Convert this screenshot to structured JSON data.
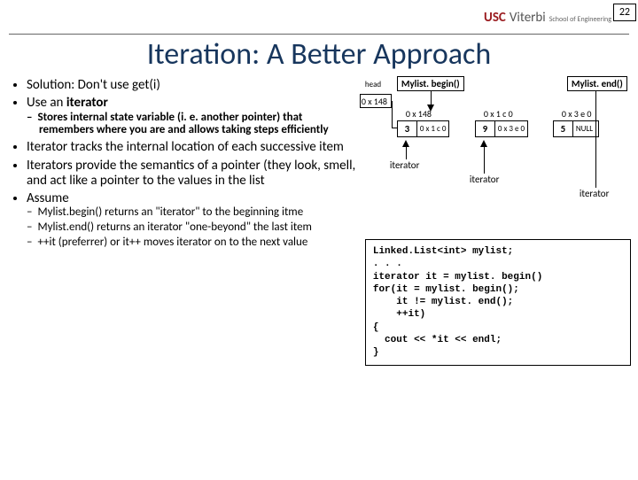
{
  "page_number": "22",
  "logo": {
    "brand": "USC",
    "school": "Viterbi",
    "sub": "School of Engineering"
  },
  "title": "Iteration: A Better Approach",
  "bullets": {
    "b1": "Solution: Don't use get(i)",
    "b2_pre": "Use an ",
    "b2_bold": "iterator",
    "b2_sub": "Stores internal state variable (i. e. another  pointer) that remembers where you are and allows taking steps efficiently",
    "b3": "Iterator tracks the internal location of each successive item",
    "b4": "Iterators provide the semantics of a pointer (they look, smell, and act like a pointer to the values in the list",
    "b5": "Assume",
    "b5_sub1": "Mylist.begin() returns an \"iterator\" to the beginning itme",
    "b5_sub2": "Mylist.end() returns an iterator \"one-beyond\" the last item",
    "b5_sub3": "++it (preferrer) or it++ moves iterator on to the next value"
  },
  "diagram": {
    "head_lbl": "head",
    "begin_lbl": "Mylist. begin()",
    "end_lbl": "Mylist. end()",
    "head_val": "0 x 148",
    "addr1": "0 x 148",
    "addr2": "0 x 1 c 0",
    "addr3": "0 x 3 e 0",
    "n1_val": "3",
    "n1_ptr": "0 x 1 c 0",
    "n2_val": "9",
    "n2_ptr": "0 x 3 e 0",
    "n3_val": "5",
    "n3_ptr": "NULL",
    "iter_lbl": "iterator"
  },
  "code": "Linked.List<int> mylist;\n. . .\niterator it = mylist. begin()\nfor(it = mylist. begin();\n    it != mylist. end();\n    ++it)\n{\n  cout << *it << endl;\n}"
}
